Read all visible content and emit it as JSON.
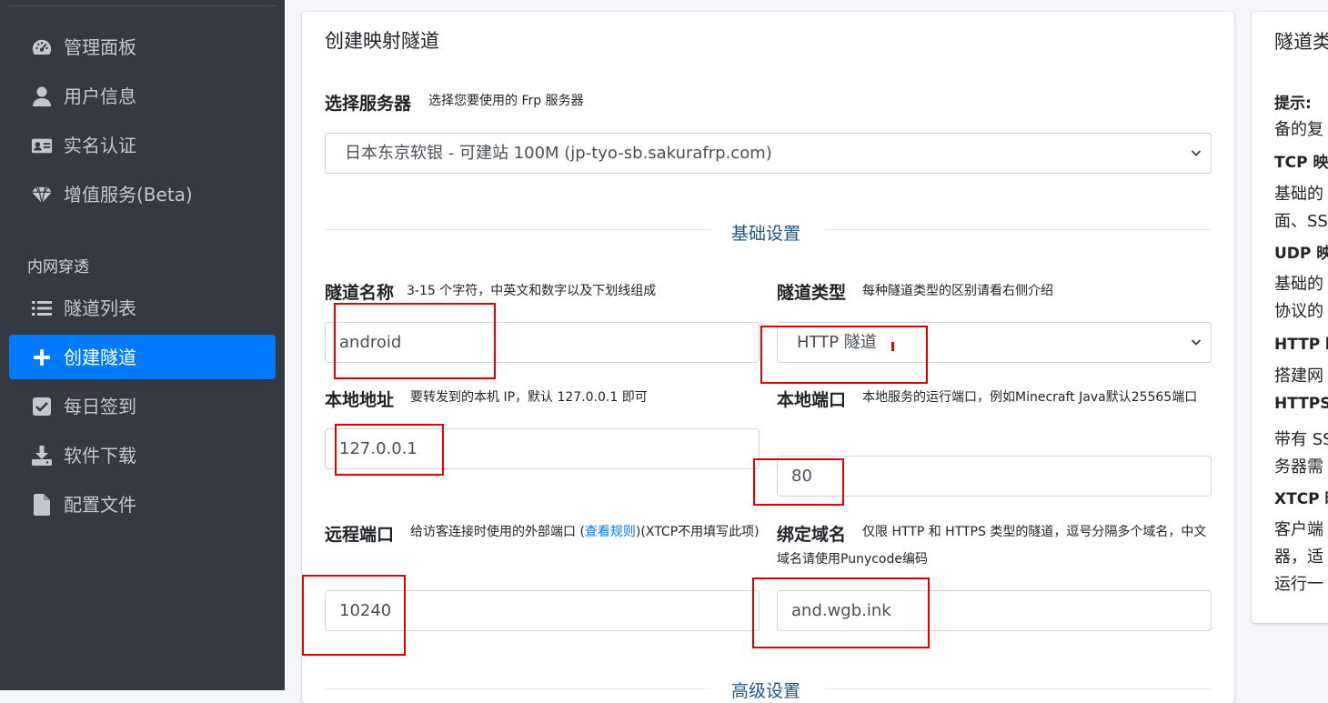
{
  "sidebar": {
    "items": [
      {
        "label": "管理面板",
        "icon": "dashboard-icon"
      },
      {
        "label": "用户信息",
        "icon": "user-icon"
      },
      {
        "label": "实名认证",
        "icon": "id-card-icon"
      },
      {
        "label": "增值服务(Beta)",
        "icon": "gem-icon"
      }
    ],
    "section_header": "内网穿透",
    "items2": [
      {
        "label": "隧道列表",
        "icon": "list-icon"
      },
      {
        "label": "创建隧道",
        "icon": "plus-icon",
        "active": true
      },
      {
        "label": "每日签到",
        "icon": "checkbox-icon"
      },
      {
        "label": "软件下载",
        "icon": "download-icon"
      },
      {
        "label": "配置文件",
        "icon": "file-icon"
      }
    ]
  },
  "main": {
    "title": "创建映射隧道",
    "server": {
      "label": "选择服务器",
      "hint": "选择您要使用的 Frp 服务器",
      "value": "日本东京软银 - 可建站 100M (jp-tyo-sb.sakurafrp.com)"
    },
    "basic_section": "基础设置",
    "tunnel_name": {
      "label": "隧道名称",
      "hint": "3-15 个字符，中英文和数字以及下划线组成",
      "value": "android"
    },
    "tunnel_type": {
      "label": "隧道类型",
      "hint": "每种隧道类型的区别请看右侧介绍",
      "value": "HTTP 隧道"
    },
    "local_addr": {
      "label": "本地地址",
      "hint": "要转发到的本机 IP，默认 127.0.0.1 即可",
      "value": "127.0.0.1"
    },
    "local_port": {
      "label": "本地端口",
      "hint": "本地服务的运行端口，例如Minecraft Java默认25565端口",
      "value": "80"
    },
    "remote_port": {
      "label": "远程端口",
      "hint_before": "给访客连接时使用的外部端口 (",
      "hint_link": "查看规则",
      "hint_after": ")(XTCP不用填写此项)",
      "value": "10240"
    },
    "domain": {
      "label": "绑定域名",
      "hint": "仅限 HTTP 和 HTTPS 类型的隧道，逗号分隔多个域名，中文域名请使用Punycode编码",
      "value": "and.wgb.ink"
    },
    "advanced_section": "高级设置"
  },
  "right_panel": {
    "title": "隧道类",
    "lines": [
      {
        "text": "提示:",
        "bold": true
      },
      {
        "text": "备的复",
        "bold": false
      },
      {
        "text": "TCP 映",
        "bold": true
      },
      {
        "text": "基础的",
        "bold": false
      },
      {
        "text": "面、SS",
        "bold": false
      },
      {
        "text": "UDP 映",
        "bold": true
      },
      {
        "text": "基础的",
        "bold": false
      },
      {
        "text": "协议的",
        "bold": false
      },
      {
        "text": "HTTP 映",
        "bold": true
      },
      {
        "text": "搭建网",
        "bold": false
      },
      {
        "text": "HTTPS",
        "bold": true
      },
      {
        "text": "带有 SS",
        "bold": false
      },
      {
        "text": "务器需",
        "bold": false
      },
      {
        "text": "XTCP 映",
        "bold": true
      },
      {
        "text": "客户端",
        "bold": false
      },
      {
        "text": "器，适",
        "bold": false
      },
      {
        "text": "运行一",
        "bold": false
      }
    ]
  },
  "colors": {
    "sidebar_bg": "#343a40",
    "active": "#007bff",
    "annotation": "#e00000"
  }
}
